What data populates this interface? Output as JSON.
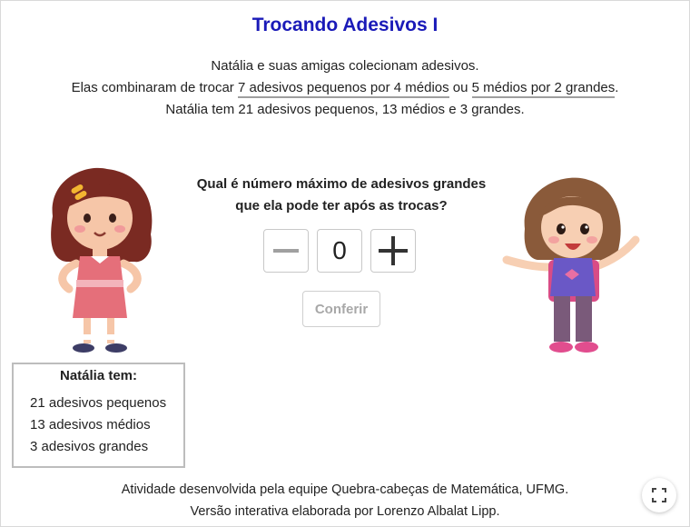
{
  "title": "Trocando Adesivos I",
  "intro": {
    "line1": "Natália e suas amigas colecionam adesivos.",
    "line2_prefix": "Elas combinaram de trocar ",
    "trade1": "7 adesivos pequenos por 4 médios",
    "line2_mid": " ou ",
    "trade2": "5 médios por 2 grandes",
    "line2_suffix": ".",
    "line3": "Natália tem 21 adesivos pequenos, 13 médios e 3 grandes."
  },
  "question": {
    "line1": "Qual é número máximo de adesivos grandes",
    "line2": "que ela pode ter após as trocas?"
  },
  "stepper": {
    "value": "0",
    "minus_icon": "minus-icon",
    "plus_icon": "plus-icon"
  },
  "check_button": "Conferir",
  "infobox": {
    "title": "Natália tem:",
    "items": [
      "21 adesivos pequenos",
      "13 adesivos médios",
      "3 adesivos grandes"
    ]
  },
  "footer": {
    "line1": "Atividade desenvolvida pela equipe Quebra-cabeças de Matemática, UFMG.",
    "line2": "Versão interativa elaborada por Lorenzo Albalat Lipp."
  },
  "icons": {
    "fullscreen": "fullscreen-icon"
  }
}
